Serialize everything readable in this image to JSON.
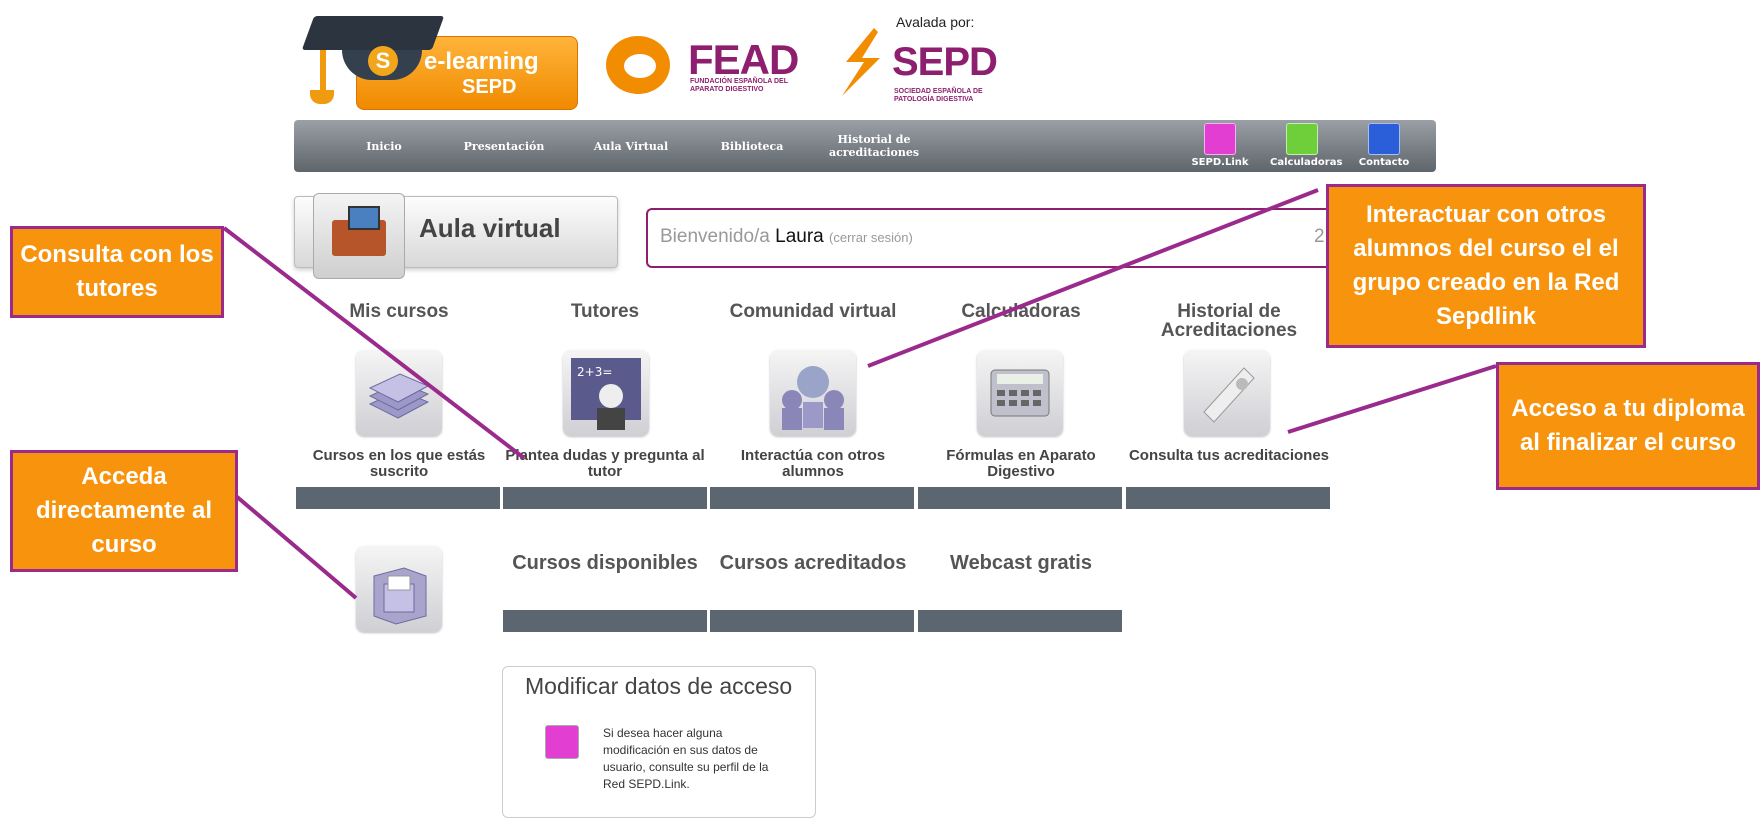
{
  "logos": {
    "elearning_line1": "e-learning",
    "elearning_line2": "SEPD",
    "elearning_badge": "S",
    "fead_name": "FEAD",
    "fead_subtitle": "FUNDACIÓN ESPAÑOLA DEL APARATO DIGESTIVO",
    "avalada": "Avalada por:",
    "sepd_name": "SEPD",
    "sepd_subtitle": "SOCIEDAD ESPAÑOLA DE PATOLOGÍA DIGESTIVA"
  },
  "nav": {
    "items": [
      "Inicio",
      "Presentación",
      "Aula Virtual",
      "Biblioteca",
      "Historial de acreditaciones"
    ],
    "icons": [
      {
        "label": "SEPD.Link",
        "icon": "sepd-link-icon",
        "color": "#e23fd2"
      },
      {
        "label": "Calculadoras",
        "icon": "calculator-icon",
        "color": "#6fcf3a"
      },
      {
        "label": "Contacto",
        "icon": "mail-icon",
        "color": "#2b5fd9"
      }
    ]
  },
  "aula": {
    "title": "Aula virtual"
  },
  "welcome": {
    "prefix": "Bienvenido/a",
    "name": "Laura",
    "logout": "(cerrar sesión)",
    "number": "2"
  },
  "sections": [
    {
      "title": "Mis cursos",
      "desc": "Cursos en los que estás suscrito",
      "icon": "papers-stack-icon"
    },
    {
      "title": "Tutores",
      "desc": "Plantea dudas y pregunta al tutor",
      "icon": "teacher-icon"
    },
    {
      "title": "Comunidad virtual",
      "desc": "Interactúa con otros alumnos",
      "icon": "community-globe-icon"
    },
    {
      "title": "Calculadoras",
      "desc": "Fórmulas en Aparato Digestivo",
      "icon": "calculator-icon"
    },
    {
      "title": "Historial de Acreditaciones",
      "desc": "Consulta tus acreditaciones",
      "icon": "diploma-icon"
    }
  ],
  "subsections": [
    "Cursos disponibles",
    "Cursos acreditados",
    "Webcast gratis"
  ],
  "cabinet_icon": "file-cabinet-icon",
  "modify": {
    "title": "Modificar datos de acceso",
    "text": "Si desea hacer alguna modificación en sus datos de usuario, consulte su perfil de la Red SEPD.Link."
  },
  "callouts": {
    "tutors": "Consulta con los tutores",
    "course": "Acceda directamente al curso",
    "community": "Interactuar con otros alumnos del curso el el grupo creado en la Red Sepdlink",
    "diploma": "Acceso a tu diploma al finalizar el curso"
  },
  "colors": {
    "accent": "#f7930d",
    "border": "#9a2a8c",
    "brand_purple": "#8e1f6e",
    "nav_gray": "#5c6670"
  }
}
